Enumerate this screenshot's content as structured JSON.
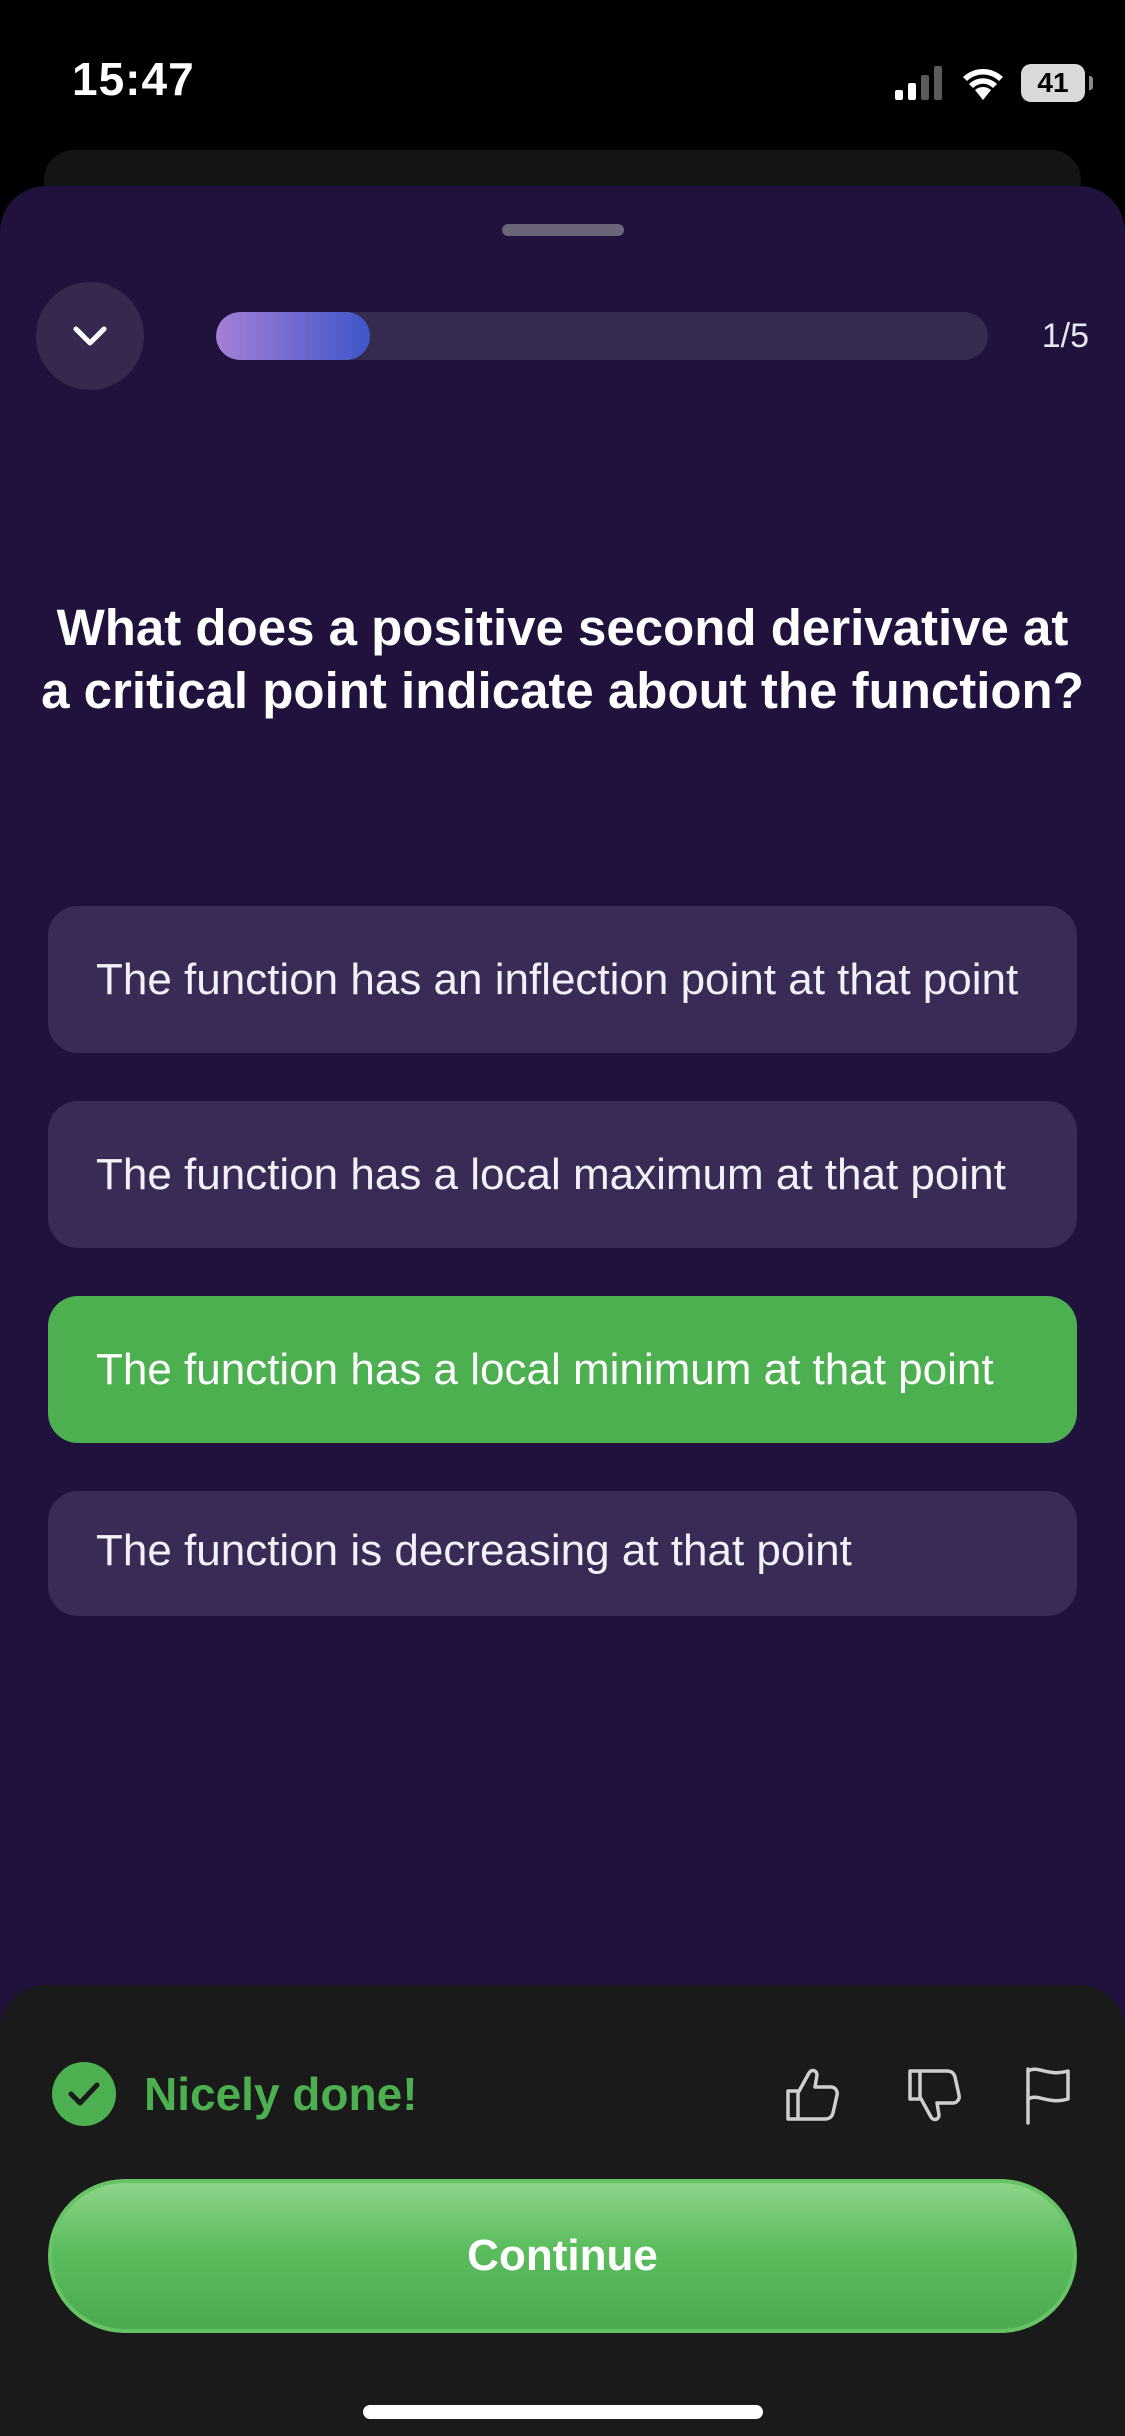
{
  "status_bar": {
    "time": "15:47",
    "battery": "41"
  },
  "progress": {
    "label": "1/5",
    "fraction": 0.2
  },
  "question": "What does a positive second derivative at a critical point indicate about the function?",
  "answers": [
    {
      "text": "The function has an inflection point at that point",
      "state": "default"
    },
    {
      "text": "The function has a local maximum at that point",
      "state": "default"
    },
    {
      "text": "The function has a local minimum at that point",
      "state": "correct"
    },
    {
      "text": "The function is decreasing at that point",
      "state": "default"
    }
  ],
  "feedback": {
    "message": "Nicely done!",
    "continue_label": "Continue"
  },
  "colors": {
    "sheet_bg": "#21113d",
    "answer_bg": "#3a2a56",
    "correct": "#4caf50",
    "panel_bg": "#1a1a1a"
  },
  "icons": [
    "signal-icon",
    "wifi-icon",
    "battery-icon",
    "chevron-down-icon",
    "check-icon",
    "thumbs-up-icon",
    "thumbs-down-icon",
    "flag-icon"
  ]
}
